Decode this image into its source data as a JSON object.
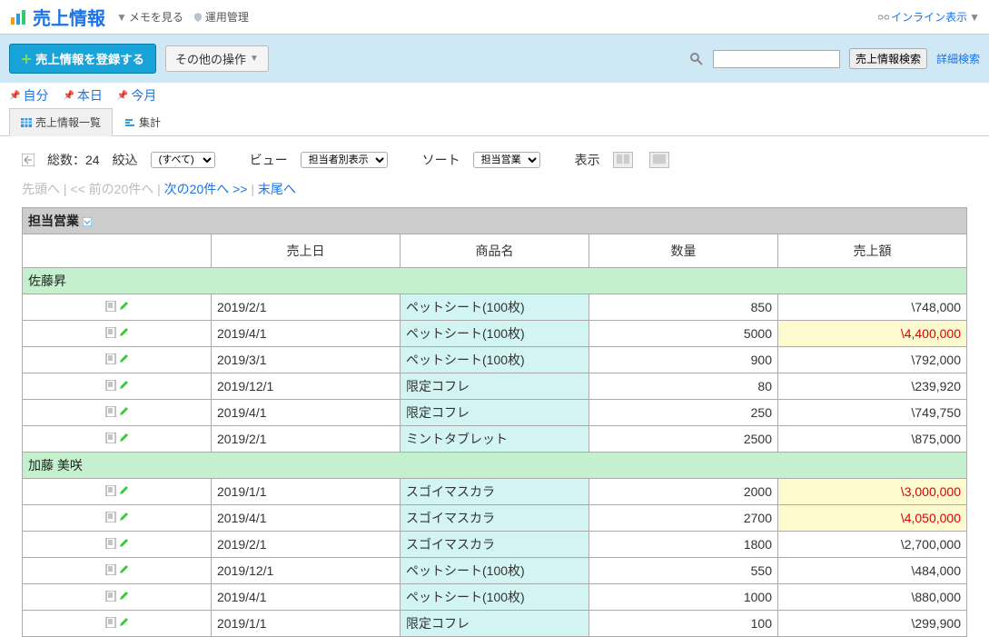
{
  "header": {
    "title": "売上情報",
    "memo": "メモを見る",
    "admin": "運用管理",
    "inline": "インライン表示"
  },
  "toolbar": {
    "register": "売上情報を登録する",
    "other_ops": "その他の操作",
    "search_btn": "売上情報検索",
    "adv_search": "詳細検索"
  },
  "tabs": {
    "self": "自分",
    "today": "本日",
    "month": "今月"
  },
  "subtabs": {
    "list": "売上情報一覧",
    "summary": "集計"
  },
  "controls": {
    "total_label": "総数：",
    "total_value": "24",
    "filter_label": "絞込",
    "filter_value": "(すべて)",
    "view_label": "ビュー",
    "view_value": "担当者別表示",
    "sort_label": "ソート",
    "sort_value": "担当営業",
    "display_label": "表示"
  },
  "pager": {
    "first": "先頭へ",
    "prev": "<< 前の20件へ",
    "next": "次の20件へ >>",
    "last": "末尾へ"
  },
  "table": {
    "group_header": "担当営業",
    "columns": {
      "date": "売上日",
      "product": "商品名",
      "qty": "数量",
      "amount": "売上額"
    },
    "groups": [
      {
        "name": "佐藤昇",
        "rows": [
          {
            "date": "2019/2/1",
            "product": "ペットシート(100枚)",
            "qty": "850",
            "amount": "\\748,000",
            "hl": false
          },
          {
            "date": "2019/4/1",
            "product": "ペットシート(100枚)",
            "qty": "5000",
            "amount": "\\4,400,000",
            "hl": true
          },
          {
            "date": "2019/3/1",
            "product": "ペットシート(100枚)",
            "qty": "900",
            "amount": "\\792,000",
            "hl": false
          },
          {
            "date": "2019/12/1",
            "product": "限定コフレ",
            "qty": "80",
            "amount": "\\239,920",
            "hl": false
          },
          {
            "date": "2019/4/1",
            "product": "限定コフレ",
            "qty": "250",
            "amount": "\\749,750",
            "hl": false
          },
          {
            "date": "2019/2/1",
            "product": "ミントタブレット",
            "qty": "2500",
            "amount": "\\875,000",
            "hl": false
          }
        ]
      },
      {
        "name": "加藤 美咲",
        "rows": [
          {
            "date": "2019/1/1",
            "product": "スゴイマスカラ",
            "qty": "2000",
            "amount": "\\3,000,000",
            "hl": true
          },
          {
            "date": "2019/4/1",
            "product": "スゴイマスカラ",
            "qty": "2700",
            "amount": "\\4,050,000",
            "hl": true
          },
          {
            "date": "2019/2/1",
            "product": "スゴイマスカラ",
            "qty": "1800",
            "amount": "\\2,700,000",
            "hl": false
          },
          {
            "date": "2019/12/1",
            "product": "ペットシート(100枚)",
            "qty": "550",
            "amount": "\\484,000",
            "hl": false
          },
          {
            "date": "2019/4/1",
            "product": "ペットシート(100枚)",
            "qty": "1000",
            "amount": "\\880,000",
            "hl": false
          },
          {
            "date": "2019/1/1",
            "product": "限定コフレ",
            "qty": "100",
            "amount": "\\299,900",
            "hl": false
          }
        ]
      }
    ]
  }
}
